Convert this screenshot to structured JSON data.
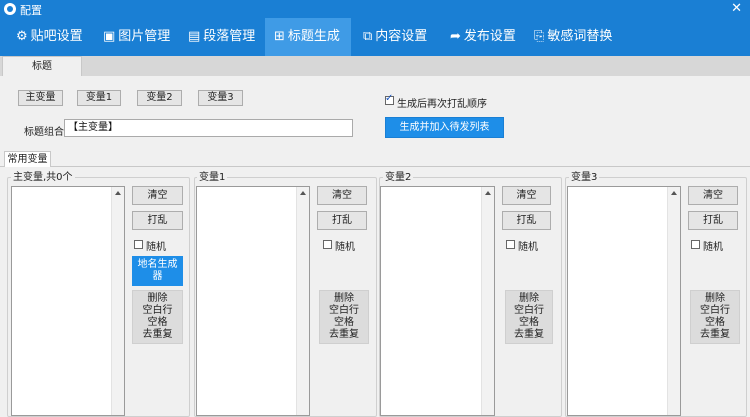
{
  "window": {
    "title": "配置",
    "close": "✕"
  },
  "nav": [
    {
      "label": "贴吧设置",
      "icon": "⚙",
      "icon_name": "gear-icon"
    },
    {
      "label": "图片管理",
      "icon": "▣",
      "icon_name": "image-icon"
    },
    {
      "label": "段落管理",
      "icon": "▤",
      "icon_name": "paragraph-icon"
    },
    {
      "label": "标题生成",
      "icon": "⊞",
      "icon_name": "title-gen-icon",
      "active": true
    },
    {
      "label": "内容设置",
      "icon": "⧉",
      "icon_name": "content-icon"
    },
    {
      "label": "发布设置",
      "icon": "➦",
      "icon_name": "share-icon"
    },
    {
      "label": "敏感词替换",
      "icon": "⎘",
      "icon_name": "sensitive-word-icon"
    }
  ],
  "tab": {
    "label": "标题"
  },
  "var_buttons": [
    "主变量",
    "变量1",
    "变量2",
    "变量3"
  ],
  "shuffle_option": {
    "label": "生成后再次打乱顺序",
    "checked": true
  },
  "title_combo": {
    "label": "标题组合",
    "value": "【主变量】"
  },
  "generate_button": "生成并加入待发列表",
  "sub_tab": "常用变量",
  "groups": [
    {
      "title": "主变量,共0个",
      "clear": "清空",
      "shuffle": "打乱",
      "random": "随机",
      "geo": [
        "地名生成",
        "器"
      ],
      "actions": [
        "删除",
        "空白行",
        "空格",
        "去重复"
      ]
    },
    {
      "title": "变量1",
      "clear": "清空",
      "shuffle": "打乱",
      "random": "随机",
      "actions": [
        "删除",
        "空白行",
        "空格",
        "去重复"
      ]
    },
    {
      "title": "变量2",
      "clear": "清空",
      "shuffle": "打乱",
      "random": "随机",
      "actions": [
        "删除",
        "空白行",
        "空格",
        "去重复"
      ]
    },
    {
      "title": "变量3",
      "clear": "清空",
      "shuffle": "打乱",
      "random": "随机",
      "actions": [
        "删除",
        "空白行",
        "空格",
        "去重复"
      ]
    }
  ],
  "colors": {
    "brand": "#1a7fd4",
    "active_nav": "#3f9be6",
    "primary_button": "#1e8ee8"
  }
}
